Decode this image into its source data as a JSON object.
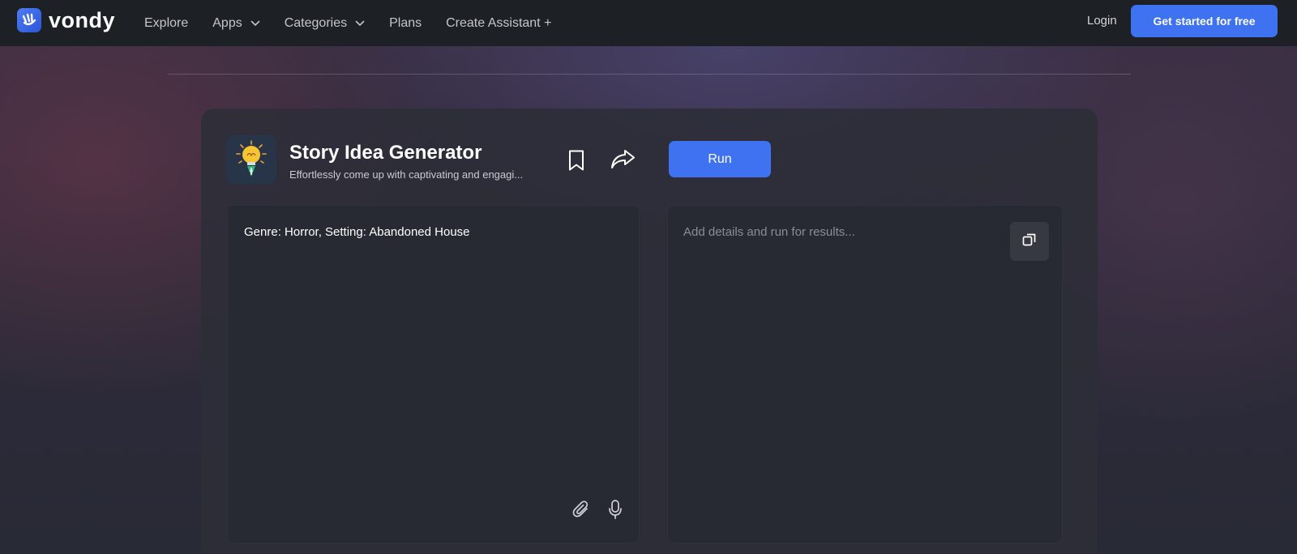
{
  "brand": {
    "name": "vondy",
    "logo_icon": "hand-wave-icon",
    "accent": "#3e72f0"
  },
  "nav": {
    "links": [
      {
        "label": "Explore"
      },
      {
        "label": "Apps",
        "has_dropdown": true
      },
      {
        "label": "Categories",
        "has_dropdown": true
      },
      {
        "label": "Plans"
      },
      {
        "label": "Create Assistant +"
      }
    ],
    "login_label": "Login",
    "cta_label": "Get started for free"
  },
  "app": {
    "icon": "lightbulb-pen-icon",
    "title": "Story Idea Generator",
    "subtitle": "Effortlessly come up with captivating and engagi...",
    "run_label": "Run"
  },
  "input": {
    "value": "Genre: Horror, Setting: Abandoned House"
  },
  "output": {
    "placeholder": "Add details and run for results..."
  }
}
